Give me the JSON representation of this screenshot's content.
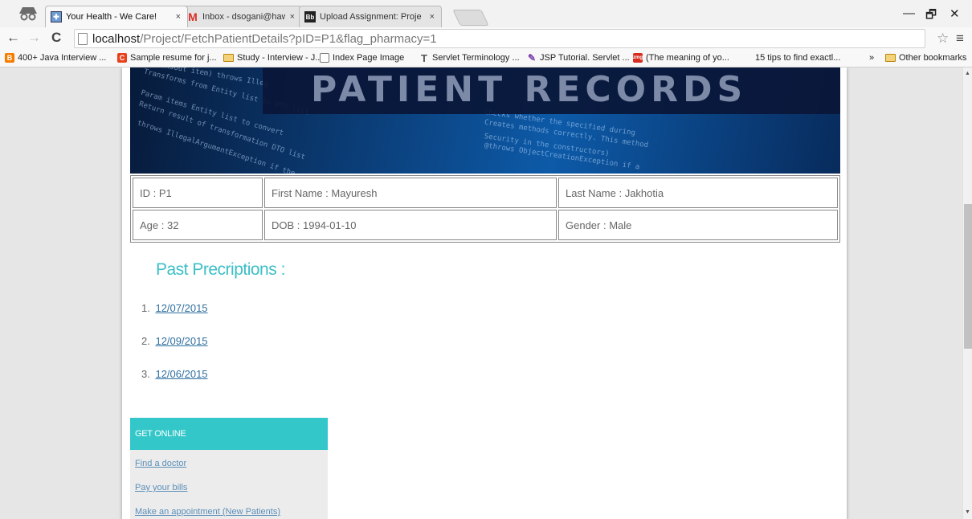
{
  "browser": {
    "tabs": [
      {
        "title": "Your Health - We Care!",
        "close": "×",
        "favicon": "health-icon"
      },
      {
        "title": "Inbox - dsogani@hawk.iit.",
        "close": "×",
        "favicon": "gmail-icon"
      },
      {
        "title": "Upload Assignment: Proje",
        "close": "×",
        "favicon": "blackboard-icon"
      }
    ],
    "address": {
      "host": "localhost",
      "path": "/Project/FetchPatientDetails?pID=P1&flag_pharmacy=1"
    },
    "bookmarks": [
      {
        "label": "400+ Java Interview ...",
        "icon": "blogger-icon",
        "color": "#f57d00",
        "glyph": "B"
      },
      {
        "label": "Sample resume for j...",
        "icon": "resume-icon",
        "color": "#e8401c",
        "glyph": "C"
      },
      {
        "label": "Study - Interview - J...",
        "icon": "folder-icon"
      },
      {
        "label": "Index Page Image",
        "icon": "page-icon"
      },
      {
        "label": "Servlet Terminology ...",
        "icon": "servlet-icon"
      },
      {
        "label": "JSP Tutorial. Servlet ...",
        "icon": "jsp-icon"
      },
      {
        "label": "(The meaning of yo...",
        "icon": "zmg-icon",
        "color": "#d62d20",
        "glyph": "zmg"
      },
      {
        "label": "15 tips to find exactl...",
        "icon": "none"
      }
    ],
    "overflow": "»",
    "other_bookmarks": "Other bookmarks",
    "window_controls": {
      "minimize": "—",
      "restore": "🗗",
      "close": "✕"
    }
  },
  "banner": {
    "title": "PATIENT RECORDS",
    "code_lines": [
      "ionsOut item) throws Illeg",
      "Transforms from Entity list to DTO list",
      "Param items Entity list to convert",
      "Return result of transformation DTO list",
      "throws IllegalArgumentException if the",
      "Checks whether the specified during",
      "Creates methods correctly. This method",
      "Security in the constructors)",
      "@throws ObjectCreationException if a"
    ]
  },
  "patient": {
    "row1": [
      "ID : P1",
      "First Name : Mayuresh",
      "Last Name : Jakhotia"
    ],
    "row2": [
      "Age : 32",
      "DOB : 1994-01-10",
      "Gender : Male"
    ]
  },
  "prescriptions": {
    "title": "Past Precriptions :",
    "items": [
      {
        "num": "1.",
        "date": "12/07/2015"
      },
      {
        "num": "2.",
        "date": "12/09/2015"
      },
      {
        "num": "3.",
        "date": "12/06/2015"
      }
    ]
  },
  "get_online": {
    "heading": "GET ONLINE",
    "links": [
      "Find a doctor",
      "Pay your bills",
      "Make an appointment (New Patients)"
    ]
  },
  "colors": {
    "accent_teal": "#33c7c9",
    "title_teal": "#3cbfc6",
    "link_blue": "#2e6fa0"
  }
}
